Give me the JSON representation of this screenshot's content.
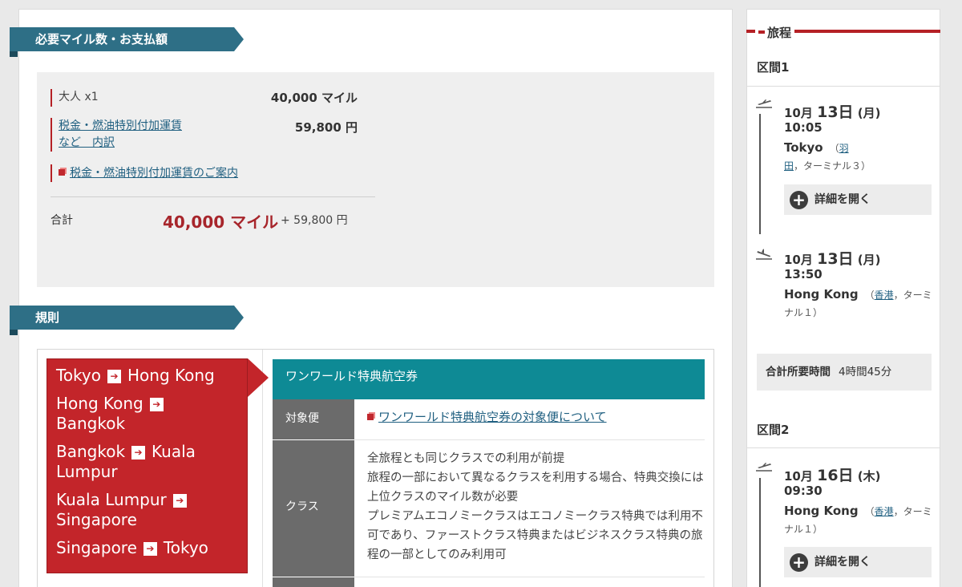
{
  "payment": {
    "section_title": "必要マイル数・お支払額",
    "adult_label": "大人 x1",
    "adult_miles": "40,000 マイル",
    "tax_link_line1": "税金・燃油特別付加運賃",
    "tax_link_line2": "など　内訳",
    "tax_amount": "59,800 円",
    "tax_info_link": "税金・燃油特別付加運賃のご案内",
    "total_label": "合計",
    "total_miles": "40,000 マイル",
    "total_yen": "+ 59,800 円"
  },
  "rules": {
    "section_title": "規則",
    "routes": [
      {
        "from": "Tokyo",
        "to": "Hong Kong"
      },
      {
        "from": "Hong Kong",
        "to": "Bangkok"
      },
      {
        "from": "Bangkok",
        "to": "Kuala Lumpur"
      },
      {
        "from": "Kuala Lumpur",
        "to": "Singapore"
      },
      {
        "from": "Singapore",
        "to": "Tokyo"
      }
    ],
    "arrow": "➔",
    "fare_title": "ワンワールド特典航空券",
    "target_label": "対象便",
    "target_link": "ワンワールド特典航空券の対象便について",
    "class_label": "クラス",
    "class_text": [
      "全旅程とも同じクラスでの利用が前提",
      "旅程の一部において異なるクラスを利用する場合、特典交換には上位クラスのマイル数が必要",
      "プレミアムエコノミークラスはエコノミークラス特典では利用不可であり、ファーストクラス特典またはビジネスクラス特典の旅程の一部としてのみ利用可"
    ]
  },
  "itinerary": {
    "title": "旅程",
    "detail_button": "詳細を開く",
    "segment1": {
      "title": "区間1",
      "dep": {
        "date_pre": "10月 ",
        "day": "13日",
        "date_post": " (月)",
        "time": "10:05",
        "city": "Tokyo",
        "paren_open": "（",
        "airport": "羽田",
        "terminal": "，ターミナル３）"
      },
      "arr": {
        "date_pre": "10月 ",
        "day": "13日",
        "date_post": " (月)",
        "time": "13:50",
        "city": "Hong Kong",
        "paren_open": "（",
        "airport": "香港",
        "terminal": "，ターミナル１）"
      },
      "total_label": "合計所要時間",
      "total_value": "4時間45分"
    },
    "segment2": {
      "title": "区間2",
      "dep": {
        "date_pre": "10月 ",
        "day": "16日",
        "date_post": " (木)",
        "time": "09:30",
        "city": "Hong Kong",
        "paren_open": "（",
        "airport": "香港",
        "terminal": "，ターミナル１）"
      }
    }
  }
}
